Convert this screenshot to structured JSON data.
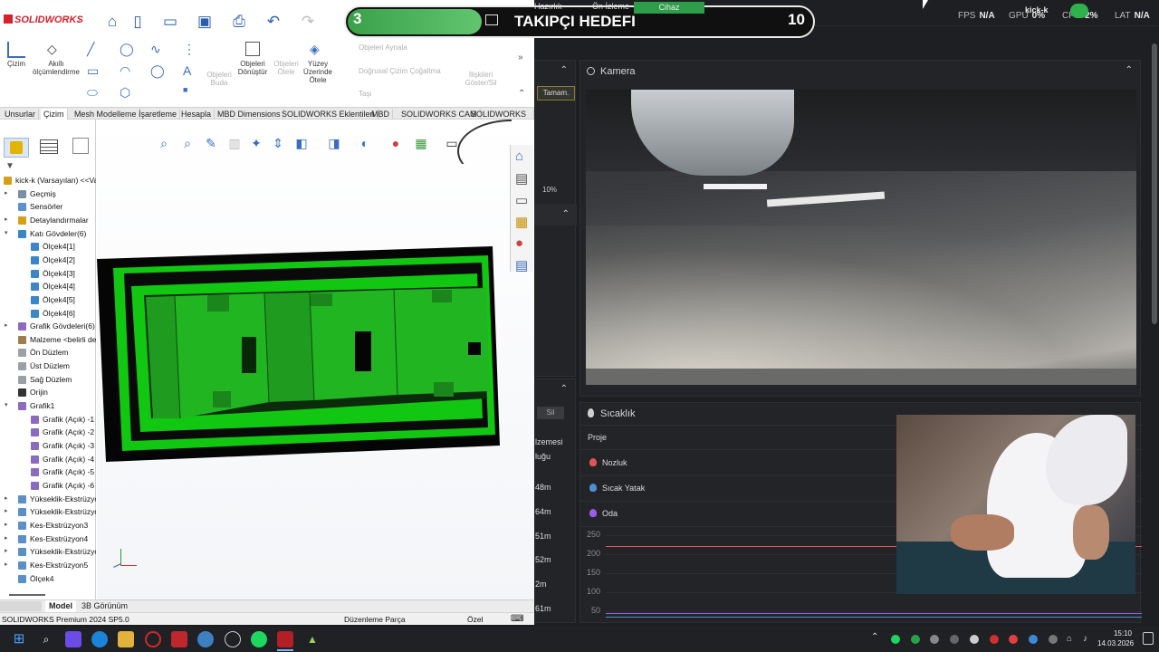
{
  "overlay": {
    "left_number": "3",
    "title": "TAKIPÇI HEDEFI",
    "right_number": "10",
    "tabs": [
      "Hazırlık",
      "Ön İzleme",
      "Cihaz"
    ]
  },
  "stats": {
    "fps_label": "FPS",
    "fps_value": "N/A",
    "gpu_label": "GPU",
    "gpu_value": "0%",
    "cpu_label": "CPU",
    "cpu_value": "2%",
    "lat_label": "LAT",
    "lat_value": "N/A",
    "kick_label": "kick-k"
  },
  "solidworks": {
    "logo": "SOLIDWORKS",
    "ribbon": {
      "cizim": "Çizim",
      "akilli": "Akıllı ölçümlendirme",
      "objeleri_buda": "Objeleri Buda",
      "objeleri_donustur": "Objeleri Dönüştür",
      "objeleri_otele": "Objeleri Ötele",
      "yuzey_uzerinde_otele": "Yüzey Üzerinde Ötele",
      "objeleri_aynala": "Objeleri Aynala",
      "dogrusal_cizim": "Doğrusal Çizim Çoğaltma",
      "tasi": "Taşı",
      "iliskileri": "İlişkileri Göster/Sil"
    },
    "tabs": [
      "Unsurlar",
      "Çizim",
      "Mesh Modelleme",
      "İşaretleme",
      "Hesapla",
      "MBD Dimensions",
      "SOLIDWORKS Eklentileri",
      "MBD",
      "SOLIDWORKS CAM",
      "SOLIDWORKS CA..."
    ],
    "tree": [
      {
        "label": "kick-k (Varsayılan) <<Va",
        "indent": 0,
        "exp": "",
        "color": "#d4a017"
      },
      {
        "label": "Geçmiş",
        "indent": 1,
        "exp": "▸",
        "color": "#7a8fa6"
      },
      {
        "label": "Sensörler",
        "indent": 1,
        "exp": "",
        "color": "#5f8fcf"
      },
      {
        "label": "Detaylandırmalar",
        "indent": 1,
        "exp": "▸",
        "color": "#d4a017"
      },
      {
        "label": "Katı Gövdeler(6)",
        "indent": 1,
        "exp": "▾",
        "color": "#3a87c8"
      },
      {
        "label": "Ölçek4[1]",
        "indent": 2,
        "exp": "",
        "color": "#3a87c8"
      },
      {
        "label": "Ölçek4[2]",
        "indent": 2,
        "exp": "",
        "color": "#3a87c8"
      },
      {
        "label": "Ölçek4[3]",
        "indent": 2,
        "exp": "",
        "color": "#3a87c8"
      },
      {
        "label": "Ölçek4[4]",
        "indent": 2,
        "exp": "",
        "color": "#3a87c8"
      },
      {
        "label": "Ölçek4[5]",
        "indent": 2,
        "exp": "",
        "color": "#3a87c8"
      },
      {
        "label": "Ölçek4[6]",
        "indent": 2,
        "exp": "",
        "color": "#3a87c8"
      },
      {
        "label": "Grafik Gövdeleri(6)",
        "indent": 1,
        "exp": "▸",
        "color": "#8a6bbf"
      },
      {
        "label": "Malzeme <belirli de",
        "indent": 1,
        "exp": "",
        "color": "#9c7d4e"
      },
      {
        "label": "Ön Düzlem",
        "indent": 1,
        "exp": "",
        "color": "#9aa0a6"
      },
      {
        "label": "Üst Düzlem",
        "indent": 1,
        "exp": "",
        "color": "#9aa0a6"
      },
      {
        "label": "Sağ Düzlem",
        "indent": 1,
        "exp": "",
        "color": "#9aa0a6"
      },
      {
        "label": "Orijin",
        "indent": 1,
        "exp": "",
        "color": "#333333"
      },
      {
        "label": "Grafik1",
        "indent": 1,
        "exp": "▾",
        "color": "#8a6bbf"
      },
      {
        "label": "Grafik (Açık) -1",
        "indent": 2,
        "exp": "",
        "color": "#8a6bbf"
      },
      {
        "label": "Grafik (Açık) -2",
        "indent": 2,
        "exp": "",
        "color": "#8a6bbf"
      },
      {
        "label": "Grafik (Açık) -3",
        "indent": 2,
        "exp": "",
        "color": "#8a6bbf"
      },
      {
        "label": "Grafik (Açık) -4",
        "indent": 2,
        "exp": "",
        "color": "#8a6bbf"
      },
      {
        "label": "Grafik (Açık) -5",
        "indent": 2,
        "exp": "",
        "color": "#8a6bbf"
      },
      {
        "label": "Grafik (Açık) -6",
        "indent": 2,
        "exp": "",
        "color": "#8a6bbf"
      },
      {
        "label": "Yükseklik-Ekstrüzyon",
        "indent": 1,
        "exp": "▸",
        "color": "#5b8fc7"
      },
      {
        "label": "Yükseklik-Ekstrüzyon",
        "indent": 1,
        "exp": "▸",
        "color": "#5b8fc7"
      },
      {
        "label": "Kes-Ekstrüzyon3",
        "indent": 1,
        "exp": "▸",
        "color": "#5b8fc7"
      },
      {
        "label": "Kes-Ekstrüzyon4",
        "indent": 1,
        "exp": "▸",
        "color": "#5b8fc7"
      },
      {
        "label": "Yükseklik-Ekstrüzyon",
        "indent": 1,
        "exp": "▸",
        "color": "#5b8fc7"
      },
      {
        "label": "Kes-Ekstrüzyon5",
        "indent": 1,
        "exp": "▸",
        "color": "#5b8fc7"
      },
      {
        "label": "Ölçek4",
        "indent": 1,
        "exp": "",
        "color": "#5b8fc7"
      }
    ],
    "bottom_tabs": [
      "Model",
      "3B Görünüm"
    ],
    "status_left": "SOLIDWORKS Premium 2024 SP5.0",
    "status_mid": "Düzenleme Parça",
    "status_right": "Özel"
  },
  "right_app": {
    "tamam": "Tamam.",
    "percent": "10%",
    "camera_title": "Kamera",
    "temp_title": "Sıcaklık",
    "proje": "Proje",
    "legend": [
      {
        "label": "Nozluk",
        "color": "#e05555"
      },
      {
        "label": "Sıcak Yatak",
        "color": "#4e8fd6"
      },
      {
        "label": "Oda",
        "color": "#9b5de5"
      }
    ],
    "left_fragments": [
      "lzemesi",
      "luğu",
      "48m",
      "64m",
      "51m",
      "52m",
      "2m",
      "61m"
    ],
    "sil": "Sil",
    "yticks": [
      "250",
      "200",
      "150",
      "100",
      "50"
    ]
  },
  "taskbar": {
    "time": "15:10",
    "date": "14.03.2026"
  }
}
